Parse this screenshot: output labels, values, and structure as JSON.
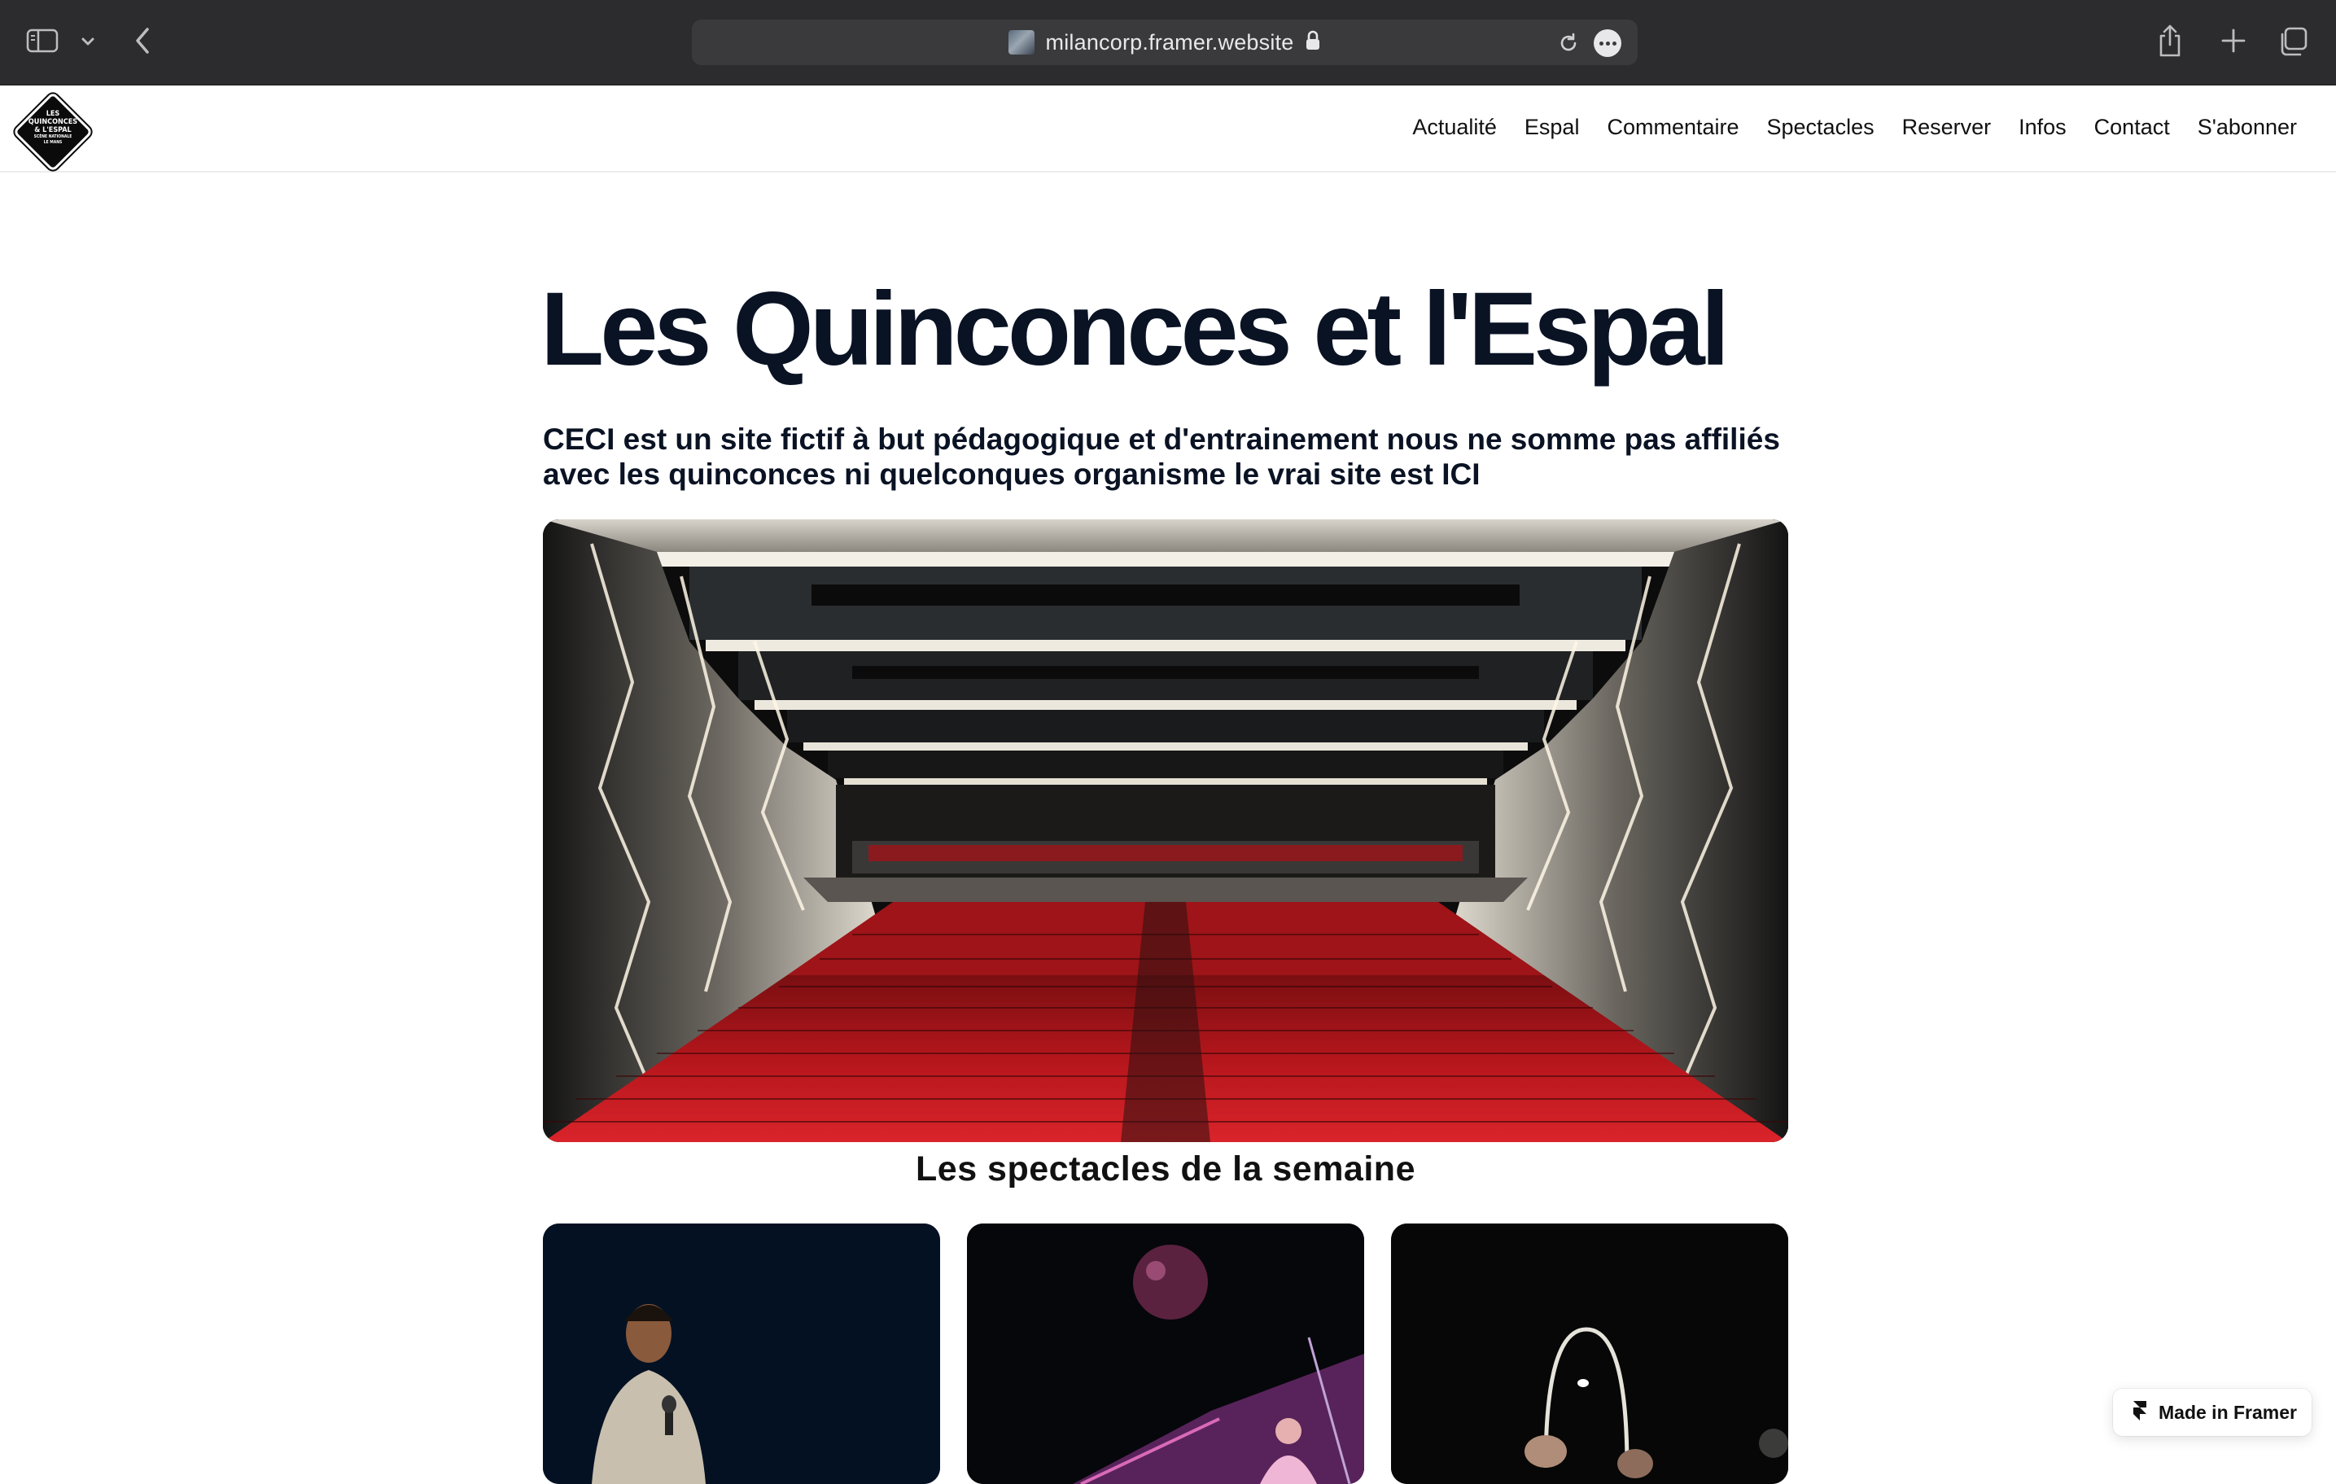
{
  "browser": {
    "url": "milancorp.framer.website"
  },
  "site": {
    "logo_lines": [
      "LES",
      "QUINCONCES",
      "& L'ESPAL",
      "SCÈNE NATIONALE",
      "LE MANS"
    ],
    "nav": [
      "Actualité",
      "Espal",
      "Commentaire",
      "Spectacles",
      "Reserver",
      "Infos",
      "Contact",
      "S'abonner"
    ]
  },
  "main": {
    "title": "Les Quinconces et l'Espal",
    "disclaimer": "CECI est un site fictif à but pédagogique et d'entrainement nous ne somme pas affiliés avec les quinconces ni quelconques organisme le vrai site est ICI",
    "section_title": "Les spectacles de la semaine"
  },
  "badge": {
    "label": "Made in Framer"
  },
  "colors": {
    "chrome_bg": "#2c2c2e",
    "address_bg": "#3a3a3c",
    "text_dark": "#0a1324",
    "seat_red": "#c0161f"
  }
}
